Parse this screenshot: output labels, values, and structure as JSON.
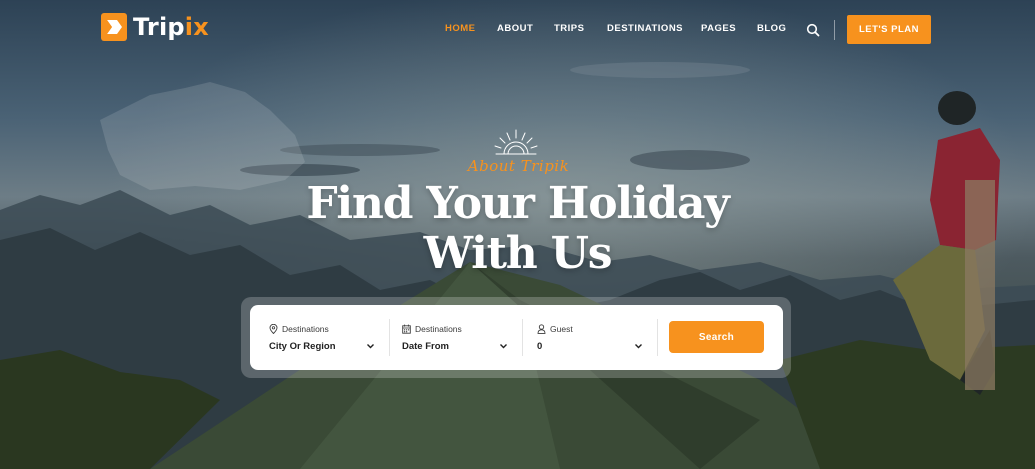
{
  "brand": {
    "name_prefix": "Trip",
    "name_accent": "ix",
    "accent_color": "#f7921e"
  },
  "nav": {
    "items": [
      {
        "label": "HOME",
        "active": true
      },
      {
        "label": "ABOUT",
        "active": false
      },
      {
        "label": "TRIPS",
        "active": false
      },
      {
        "label": "DESTINATIONS",
        "active": false
      },
      {
        "label": "PAGES",
        "active": false
      },
      {
        "label": "BLOG",
        "active": false
      }
    ],
    "search_icon": "search-icon",
    "cta_label": "LET'S PLAN"
  },
  "hero": {
    "kicker": "About Tripik",
    "title_line1": "Find Your Holiday",
    "title_line2": "With Us",
    "background": "mountain-camping-photo"
  },
  "search_form": {
    "fields": [
      {
        "label": "Destinations",
        "value": "City Or Region",
        "icon": "map-pin-icon"
      },
      {
        "label": "Destinations",
        "value": "Date From",
        "icon": "calendar-icon"
      },
      {
        "label": "Guest",
        "value": "0",
        "icon": "user-icon"
      }
    ],
    "submit_label": "Search"
  }
}
